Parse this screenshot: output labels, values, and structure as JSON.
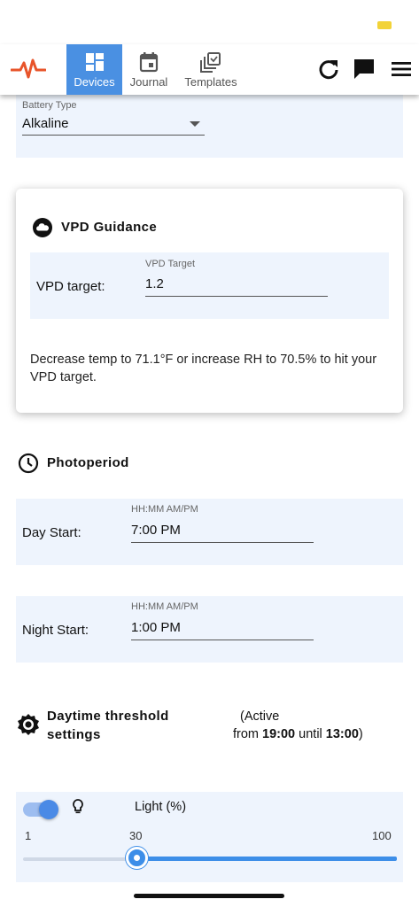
{
  "header": {
    "tabs": [
      {
        "label": "Devices",
        "active": true,
        "icon": "dashboard-icon"
      },
      {
        "label": "Journal",
        "active": false,
        "icon": "calendar-icon"
      },
      {
        "label": "Templates",
        "active": false,
        "icon": "template-stack-icon"
      }
    ],
    "accent_color": "#4a90e2",
    "logo_color": "#e8542a"
  },
  "battery_type": {
    "label": "Battery Type",
    "value": "Alkaline"
  },
  "vpd": {
    "title": "VPD Guidance",
    "row_label": "VPD target:",
    "field_label": "VPD Target",
    "field_value": "1.2",
    "guidance": "Decrease temp to 71.1°F or increase RH to 70.5% to hit your VPD target."
  },
  "photoperiod": {
    "title": "Photoperiod",
    "day": {
      "row_label": "Day Start:",
      "field_label": "HH:MM AM/PM",
      "value": "7:00 PM"
    },
    "night": {
      "row_label": "Night Start:",
      "field_label": "HH:MM AM/PM",
      "value": "1:00 PM"
    }
  },
  "threshold": {
    "title_line1": "Daytime threshold",
    "title_line2": "settings",
    "active_line1": "(Active",
    "from_word": "from",
    "from_time": "19:00",
    "until_word": "until",
    "until_time": "13:00",
    "close_paren": ")"
  },
  "light": {
    "label": "Light (%)",
    "toggle_on": true,
    "min": "1",
    "value": "30",
    "max": "100"
  }
}
